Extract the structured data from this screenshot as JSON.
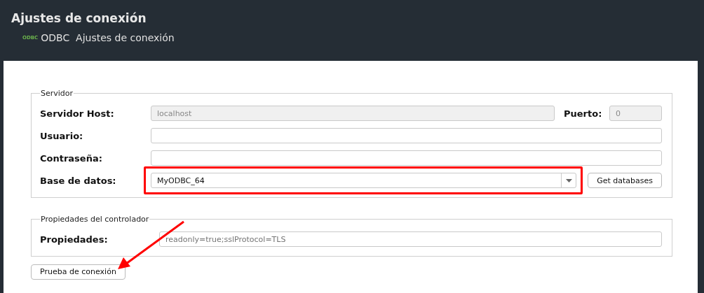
{
  "window": {
    "title": "Ajustes de conexión",
    "subtitle_badge": "ODBC",
    "subtitle": "ODBC  Ajustes de conexión"
  },
  "server_group": {
    "legend": "Servidor",
    "host": {
      "label": "Servidor Host:",
      "value": "localhost",
      "disabled": true
    },
    "port": {
      "label": "Puerto:",
      "value": "0",
      "disabled": true
    },
    "user": {
      "label": "Usuario:",
      "disabled": false
    },
    "password": {
      "label": "Contraseña:",
      "disabled": false
    },
    "database": {
      "label": "Base de datos:",
      "value": "MyODBC_64",
      "highlighted": true
    },
    "get_databases_button": "Get databases"
  },
  "driver_group": {
    "legend": "Propiedades del controlador",
    "properties": {
      "label": "Propiedades:",
      "placeholder": "readonly=true;sslProtocol=TLS"
    }
  },
  "test_button": "Prueba de conexión"
}
